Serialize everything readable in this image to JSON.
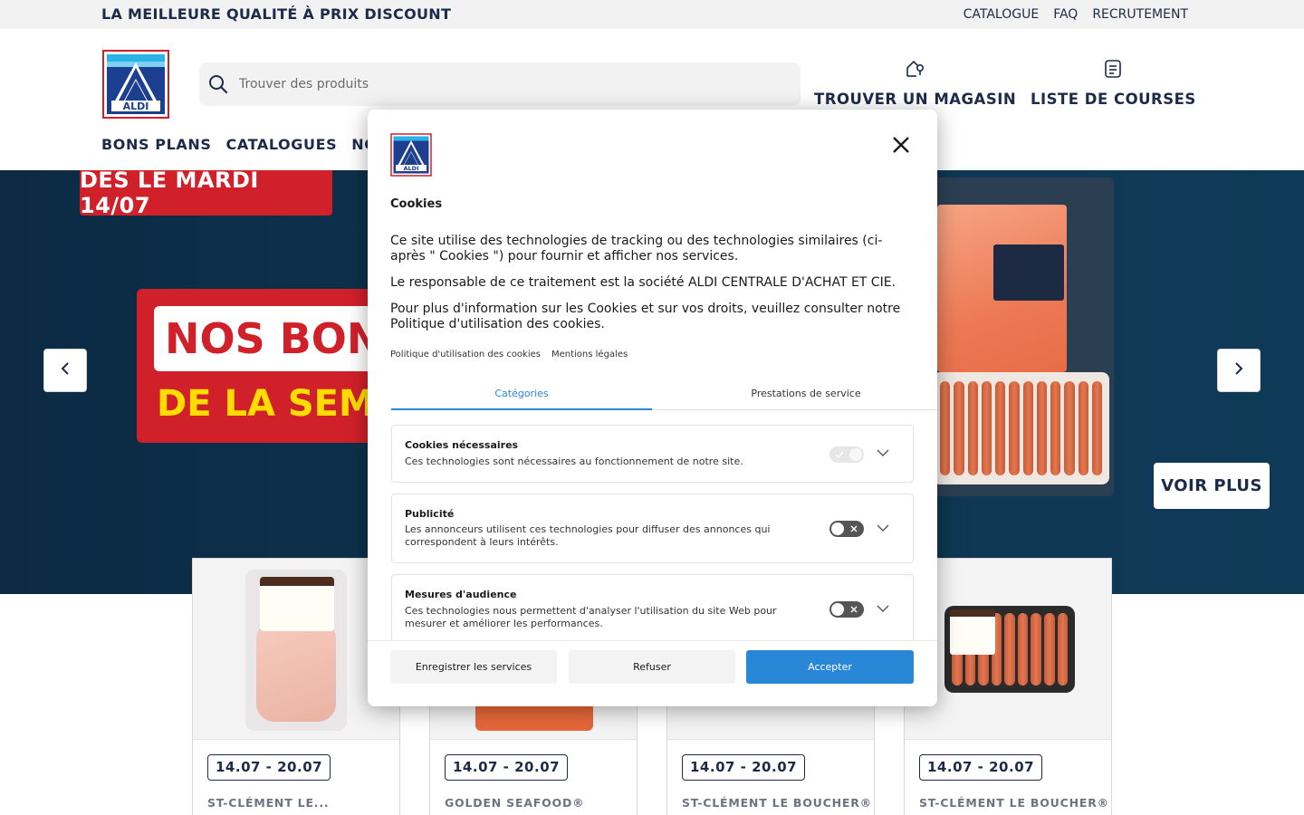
{
  "topbar": {
    "tagline": "LA MEILLEURE QUALITÉ À PRIX DISCOUNT",
    "links": [
      "CATALOGUE",
      "FAQ",
      "RECRUTEMENT"
    ]
  },
  "header": {
    "logo_text": "ALDI",
    "search_placeholder": "Trouver des produits",
    "find_store": "TROUVER UN MAGASIN",
    "shopping_list": "LISTE DE COURSES"
  },
  "nav": {
    "items": [
      "BONS PLANS",
      "CATALOGUES",
      "NO"
    ]
  },
  "hero": {
    "date_badge": "DÈS LE MARDI 14/07",
    "banner_line1": "NOS BON",
    "banner_line2": "DE LA SEMA",
    "cta": "VOIR PLUS"
  },
  "products": [
    {
      "date": "14.07 - 20.07",
      "brand": "ST-CLÉMENT LE..."
    },
    {
      "date": "14.07 - 20.07",
      "brand": "GOLDEN SEAFOOD®"
    },
    {
      "date": "14.07 - 20.07",
      "brand": "ST-CLÉMENT LE BOUCHER®"
    },
    {
      "date": "14.07 - 20.07",
      "brand": "ST-CLÉMENT LE BOUCHER®"
    }
  ],
  "cookie_modal": {
    "title": "Cookies",
    "para1": "Ce site utilise des technologies de tracking ou des technologies similaires (ci-après \" Cookies \") pour fournir et afficher nos services.",
    "para2": "Le responsable de ce traitement est la société ALDI CENTRALE D'ACHAT ET CIE.",
    "para3": "Pour plus d'information sur les Cookies et sur vos droits, veuillez consulter notre Politique d'utilisation des cookies.",
    "links": [
      "Politique d'utilisation des cookies",
      "Mentions légales"
    ],
    "tabs": [
      "Catégories",
      "Prestations de service"
    ],
    "categories": [
      {
        "title": "Cookies nécessaires",
        "desc": "Ces technologies sont nécessaires au fonctionnement de notre site.",
        "enabled": true,
        "locked": true
      },
      {
        "title": "Publicité",
        "desc": "Les annonceurs utilisent ces technologies pour diffuser des annonces qui correspondent à leurs intérêts.",
        "enabled": false,
        "locked": false
      },
      {
        "title": "Mesures d'audience",
        "desc": "Ces technologies nous permettent d'analyser l'utilisation du site Web pour mesurer et améliorer les performances.",
        "enabled": false,
        "locked": false
      }
    ],
    "buttons": {
      "save": "Enregistrer les services",
      "refuse": "Refuser",
      "accept": "Accepter"
    }
  },
  "colors": {
    "brand_navy": "#1c2b4a",
    "brand_red": "#d0202a",
    "accent_blue": "#2a86d6",
    "hero_bg": "#0e3550"
  },
  "icons": [
    "search-icon",
    "store-icon",
    "list-icon",
    "chevron-left-icon",
    "chevron-right-icon",
    "close-icon",
    "chevron-down-icon"
  ]
}
